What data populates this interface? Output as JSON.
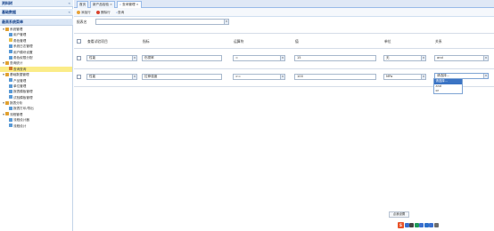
{
  "left_panel": {
    "header_1": "资料树",
    "header_2": "基础数据",
    "header_3": "最高系统菜单",
    "collapse_glyph": "«",
    "tree": [
      {
        "label": "系统管理",
        "level": 0,
        "toggle": "▾",
        "icon_color": "#e0a030"
      },
      {
        "label": "用户管理",
        "level": 1,
        "toggle": "",
        "icon_color": "#5a9ad6"
      },
      {
        "label": "角色管理",
        "level": 1,
        "toggle": "",
        "icon_color": "#e8c14a"
      },
      {
        "label": "系统日志管理",
        "level": 1,
        "toggle": "",
        "icon_color": "#5a9ad6"
      },
      {
        "label": "用户模块设置",
        "level": 1,
        "toggle": "",
        "icon_color": "#5a9ad6"
      },
      {
        "label": "角色权限分配",
        "level": 1,
        "toggle": "",
        "icon_color": "#5a9ad6"
      },
      {
        "label": "查询统计",
        "level": 0,
        "toggle": "▾",
        "icon_color": "#e0a030"
      },
      {
        "label": "查询查询",
        "level": 1,
        "toggle": "",
        "icon_color": "#d07a2a",
        "selected": true
      },
      {
        "label": "基础数据管理",
        "level": 0,
        "toggle": "▾",
        "icon_color": "#e0a030"
      },
      {
        "label": "产品管理",
        "level": 1,
        "toggle": "",
        "icon_color": "#5a9ad6"
      },
      {
        "label": "单位管理",
        "level": 1,
        "toggle": "",
        "icon_color": "#5a9ad6"
      },
      {
        "label": "报表模板管理",
        "level": 1,
        "toggle": "",
        "icon_color": "#5a9ad6"
      },
      {
        "label": "试验模板管理",
        "level": 1,
        "toggle": "",
        "icon_color": "#5a9ad6"
      },
      {
        "label": "报表分析",
        "level": 0,
        "toggle": "▾",
        "icon_color": "#e0a030"
      },
      {
        "label": "报表打印/导出",
        "level": 1,
        "toggle": "",
        "icon_color": "#5a9ad6"
      },
      {
        "label": "流程管理",
        "level": 0,
        "toggle": "▾",
        "icon_color": "#e0a030"
      },
      {
        "label": "流程设计器",
        "level": 1,
        "toggle": "",
        "icon_color": "#5a9ad6"
      },
      {
        "label": "流程设计",
        "level": 1,
        "toggle": "",
        "icon_color": "#5a9ad6"
      }
    ]
  },
  "tabs": [
    {
      "label": "首页",
      "closable": false,
      "active": false
    },
    {
      "label": "新产品检验",
      "closable": true,
      "active": false
    },
    {
      "label": "查询管理",
      "closable": true,
      "active": true
    }
  ],
  "toolbar": {
    "add_label": "添加行",
    "delete_label": "删除行",
    "query_label": "查询"
  },
  "query_row": {
    "label": "报表名",
    "select_value": ""
  },
  "table": {
    "headers": [
      "查看试验项目",
      "指标",
      "运算符",
      "值",
      "单位",
      "关系"
    ],
    "rows": [
      {
        "category": "性能",
        "indicator": "伤损率",
        "operator": "=",
        "value": "15",
        "unit": "无",
        "relation": "and"
      },
      {
        "category": "性能",
        "indicator": "拉伸强度",
        "operator": ">=",
        "value": "100",
        "unit": "MPa",
        "relation": "请选择..."
      }
    ]
  },
  "relation_dropdown": {
    "options": [
      "请选择...",
      "and",
      "or"
    ],
    "highlighted_index": 0
  },
  "tray": {
    "label": "点我设置",
    "logo_text": "S",
    "icons": [
      "#3a6fcf",
      "#444444",
      "#1e9b5a",
      "#3a6fcf",
      "#2b6fc9",
      "#3a6fcf",
      "#6d6d6d"
    ]
  },
  "colors": {
    "accent": "#15428b",
    "selection": "#fbec88",
    "highlight": "#3b74c4"
  }
}
